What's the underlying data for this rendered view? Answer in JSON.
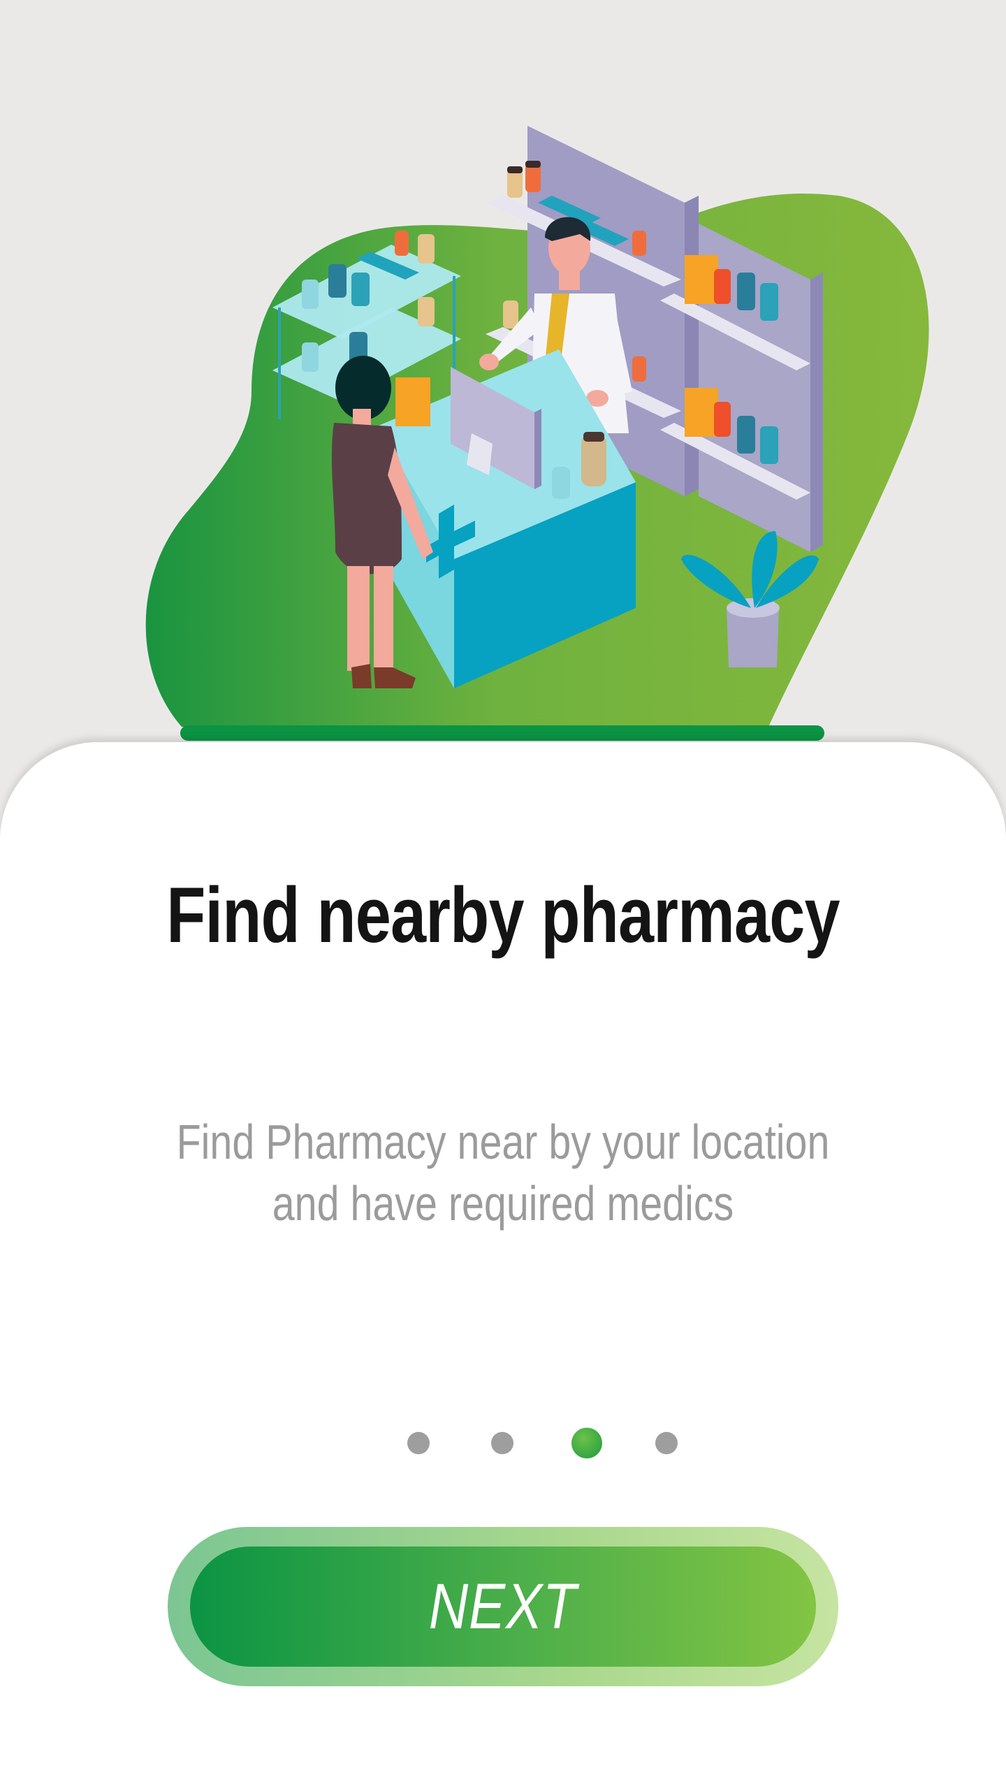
{
  "onboarding": {
    "illustration": "pharmacy-counter-illustration",
    "title": "Find nearby pharmacy",
    "description_lines": [
      "Find Pharmacy near by your location",
      "and have required medics"
    ],
    "pager": {
      "total": 4,
      "active_index": 2
    },
    "next_label": "NEXT"
  },
  "colors": {
    "background": "#ebe9e8",
    "card": "#ffffff",
    "accent_green": "#0b9443",
    "accent_light_green": "#83c443",
    "dot_inactive": "#9e9e9e",
    "title_text": "#141414",
    "body_text": "#9b9b9b"
  }
}
